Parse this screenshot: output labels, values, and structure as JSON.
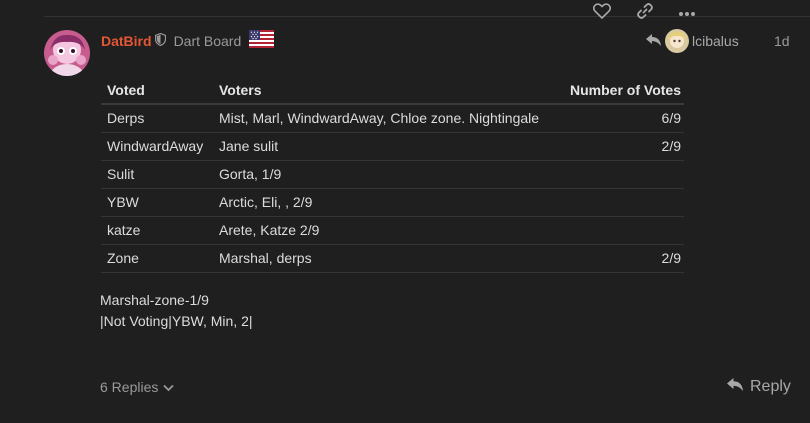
{
  "post": {
    "username": "DatBird",
    "user_title": "Dart Board",
    "reply_to_user": "lcibalus",
    "date": "1d"
  },
  "table": {
    "headers": [
      "Voted",
      "Voters",
      "Number of Votes"
    ],
    "rows": [
      {
        "voted": "Derps",
        "voters": "Mist, Marl, WindwardAway, Chloe zone. Nightingale",
        "count": "6/9"
      },
      {
        "voted": "WindwardAway",
        "voters": "Jane sulit",
        "count": "2/9"
      },
      {
        "voted": "Sulit",
        "voters": "Gorta, 1/9",
        "count": ""
      },
      {
        "voted": "YBW",
        "voters": "Arctic, Eli, , 2/9",
        "count": ""
      },
      {
        "voted": "katze",
        "voters": "Arete, Katze 2/9",
        "count": ""
      },
      {
        "voted": "Zone",
        "voters": "Marshal, derps",
        "count": "2/9"
      }
    ]
  },
  "after_lines": [
    "Marshal-zone-1/9",
    "|Not Voting|YBW, Min, 2|"
  ],
  "footer": {
    "replies_label": "6 Replies",
    "reply_label": "Reply"
  },
  "colors": {
    "background": "#1f1f1f",
    "username": "#e45735",
    "muted": "#9a9a9a"
  },
  "icons": [
    "shield-icon",
    "us-flag-icon",
    "reply-arrow-icon",
    "chevron-down-icon",
    "heart-icon",
    "link-icon",
    "ellipsis-icon"
  ]
}
